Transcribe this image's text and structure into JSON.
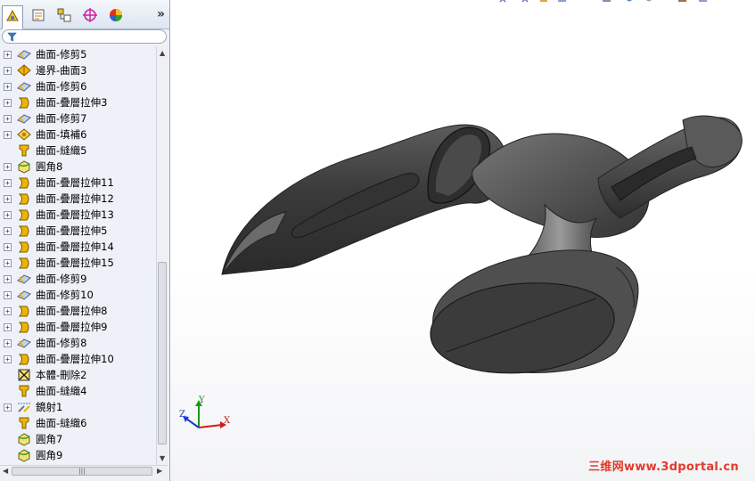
{
  "panel": {
    "tabs": [
      {
        "icon": "feature-manager-icon",
        "active": true
      },
      {
        "icon": "property-manager-icon",
        "active": false
      },
      {
        "icon": "configuration-manager-icon",
        "active": false
      },
      {
        "icon": "dimxpert-manager-icon",
        "active": false
      },
      {
        "icon": "display-manager-icon",
        "active": false
      }
    ],
    "more_label": "»",
    "filter_icon": "filter-icon",
    "tree": [
      {
        "label": "曲面-修剪5",
        "icon": "trim-surface-icon",
        "expandable": true
      },
      {
        "label": "邊界-曲面3",
        "icon": "boundary-surface-icon",
        "expandable": true
      },
      {
        "label": "曲面-修剪6",
        "icon": "trim-surface-icon",
        "expandable": true
      },
      {
        "label": "曲面-疊層拉伸3",
        "icon": "loft-surface-icon",
        "expandable": true
      },
      {
        "label": "曲面-修剪7",
        "icon": "trim-surface-icon",
        "expandable": true
      },
      {
        "label": "曲面-填補6",
        "icon": "fill-surface-icon",
        "expandable": true
      },
      {
        "label": "曲面-縫織5",
        "icon": "knit-surface-icon",
        "expandable": false
      },
      {
        "label": "圓角8",
        "icon": "fillet-icon",
        "expandable": true
      },
      {
        "label": "曲面-疊層拉伸11",
        "icon": "loft-surface-icon",
        "expandable": true
      },
      {
        "label": "曲面-疊層拉伸12",
        "icon": "loft-surface-icon",
        "expandable": true
      },
      {
        "label": "曲面-疊層拉伸13",
        "icon": "loft-surface-icon",
        "expandable": true
      },
      {
        "label": "曲面-疊層拉伸5",
        "icon": "loft-surface-icon",
        "expandable": true
      },
      {
        "label": "曲面-疊層拉伸14",
        "icon": "loft-surface-icon",
        "expandable": true
      },
      {
        "label": "曲面-疊層拉伸15",
        "icon": "loft-surface-icon",
        "expandable": true
      },
      {
        "label": "曲面-修剪9",
        "icon": "trim-surface-icon",
        "expandable": true
      },
      {
        "label": "曲面-修剪10",
        "icon": "trim-surface-icon",
        "expandable": true
      },
      {
        "label": "曲面-疊層拉伸8",
        "icon": "loft-surface-icon",
        "expandable": true
      },
      {
        "label": "曲面-疊層拉伸9",
        "icon": "loft-surface-icon",
        "expandable": true
      },
      {
        "label": "曲面-修剪8",
        "icon": "trim-surface-icon",
        "expandable": true
      },
      {
        "label": "曲面-疊層拉伸10",
        "icon": "loft-surface-icon",
        "expandable": true
      },
      {
        "label": "本體-刪除2",
        "icon": "delete-body-icon",
        "expandable": false
      },
      {
        "label": "曲面-縫織4",
        "icon": "knit-surface-icon",
        "expandable": false
      },
      {
        "label": "鏡射1",
        "icon": "mirror-icon",
        "expandable": true
      },
      {
        "label": "曲面-縫織6",
        "icon": "knit-surface-icon",
        "expandable": false
      },
      {
        "label": "圓角7",
        "icon": "fillet-icon",
        "expandable": false
      },
      {
        "label": "圓角9",
        "icon": "fillet-icon",
        "expandable": false
      }
    ]
  },
  "viewport": {
    "triad": {
      "x": "X",
      "y": "Y",
      "z": "Z"
    },
    "watermark": "三维网www.3dportal.cn"
  },
  "colors": {
    "panel_bg": "#eef2f8",
    "model_dark": "#3c3c3c",
    "model_light": "#8a8a8a",
    "feature_yellow": "#f0b400",
    "watermark": "#e23a2a"
  }
}
